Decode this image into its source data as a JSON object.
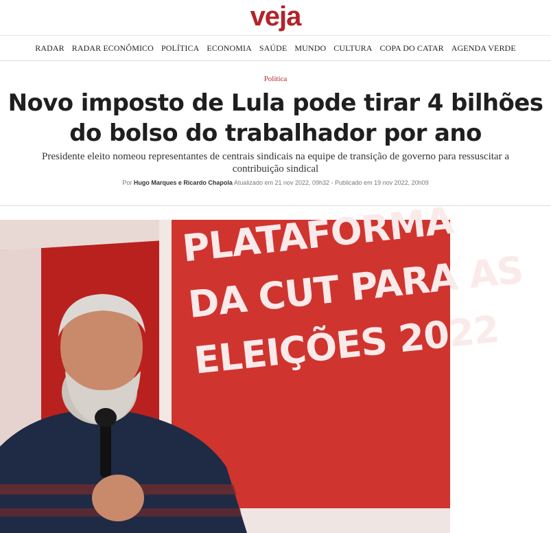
{
  "site": {
    "logo": "veja"
  },
  "nav": {
    "items": [
      "RADAR",
      "RADAR ECONÔMICO",
      "POLÍTICA",
      "ECONOMIA",
      "SAÚDE",
      "MUNDO",
      "CULTURA",
      "COPA DO CATAR",
      "AGENDA VERDE"
    ]
  },
  "article": {
    "category": "Política",
    "title": "Novo imposto de Lula pode tirar 4 bilhões do bolso do trabalhador por ano",
    "subtitle": "Presidente eleito nomeou representantes de centrais sindicais na equipe de transição de governo para ressuscitar a contribuição sindical",
    "byline_prefix": "Por",
    "authors": "Hugo Marques e Ricardo Chapola",
    "updated": "Atualizado em 21 nov 2022, 09h32",
    "separator": " - ",
    "published": "Publicado em 19 nov 2022, 20h09"
  },
  "photo": {
    "sign_lines": [
      "PLATAFORMA",
      "DA CUT PARA AS",
      "ELEIÇÕES 2022"
    ]
  },
  "colors": {
    "brand": "#b3232a",
    "sign_red": "#c9302c"
  }
}
